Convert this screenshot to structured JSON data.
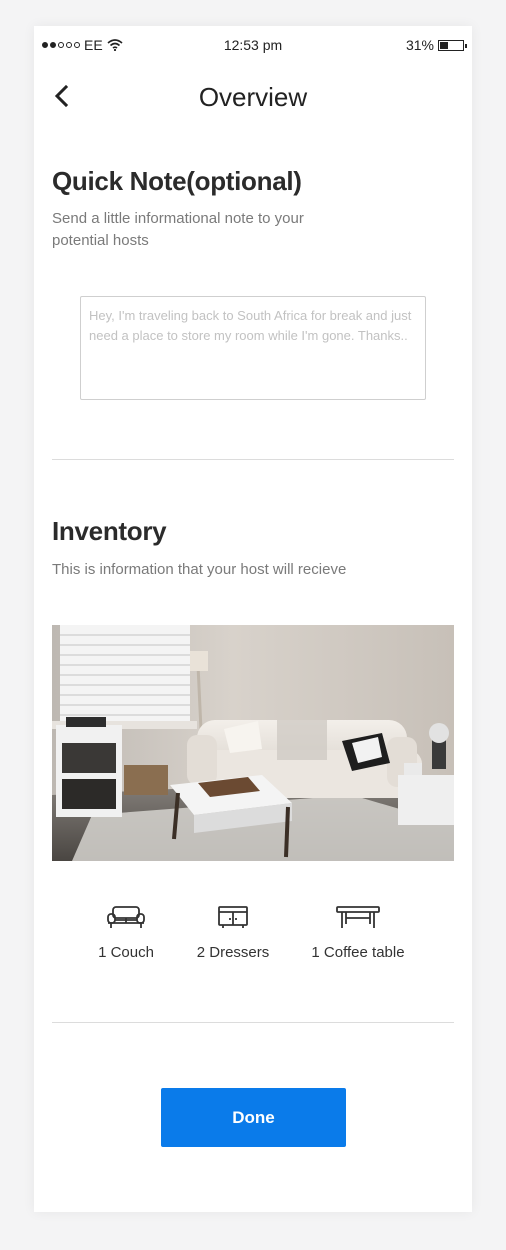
{
  "status_bar": {
    "carrier": "EE",
    "time": "12:53 pm",
    "battery": "31%",
    "battery_level": 0.31,
    "signal_bars": 2,
    "signal_total": 5
  },
  "nav": {
    "back_icon": "chevron-left-icon",
    "title": "Overview"
  },
  "quick_note": {
    "heading": "Quick Note(optional)",
    "description": "Send a little informational note to your potential hosts",
    "placeholder": "Hey, I'm traveling back to South Africa for break and just need a place to store my room while I'm gone. Thanks..",
    "value": ""
  },
  "inventory": {
    "heading": "Inventory",
    "description": "This is information that your host will recieve",
    "image": "living-room-photo",
    "items": [
      {
        "icon": "couch-icon",
        "label": "1 Couch"
      },
      {
        "icon": "dresser-icon",
        "label": "2 Dressers"
      },
      {
        "icon": "coffee-table-icon",
        "label": "1 Coffee table"
      }
    ]
  },
  "done_button": {
    "label": "Done"
  },
  "colors": {
    "primary": "#0a7bea",
    "heading": "#2b2b2b",
    "muted": "#7a7a7a",
    "divider": "#dcdcdc"
  }
}
